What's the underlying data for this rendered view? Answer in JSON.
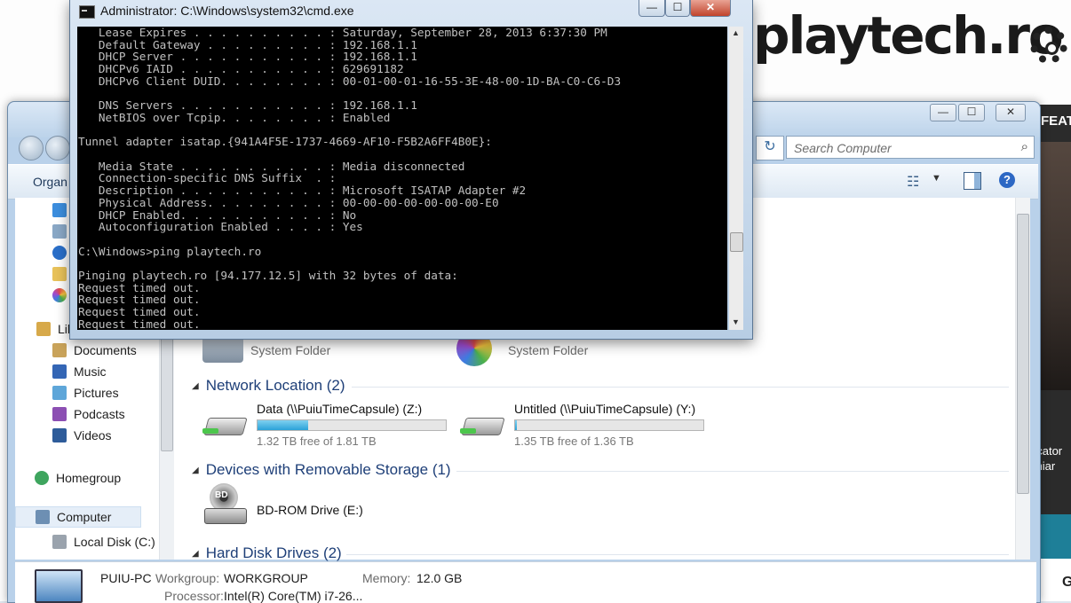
{
  "website": {
    "logo": "playtech.ro",
    "feat": "FEAT",
    "caption": "ucator\nchiar",
    "corner": "G"
  },
  "cmd": {
    "title": "Administrator: C:\\Windows\\system32\\cmd.exe",
    "buttons": {
      "minimize": "—",
      "maximize": "☐",
      "close": "✕"
    },
    "output": "   Lease Expires . . . . . . . . . . : Saturday, September 28, 2013 6:37:30 PM\n   Default Gateway . . . . . . . . . : 192.168.1.1\n   DHCP Server . . . . . . . . . . . : 192.168.1.1\n   DHCPv6 IAID . . . . . . . . . . . : 629691182\n   DHCPv6 Client DUID. . . . . . . . : 00-01-00-01-16-55-3E-48-00-1D-BA-C0-C6-D3\n\n   DNS Servers . . . . . . . . . . . : 192.168.1.1\n   NetBIOS over Tcpip. . . . . . . . : Enabled\n\nTunnel adapter isatap.{941A4F5E-1737-4669-AF10-F5B2A6FF4B0E}:\n\n   Media State . . . . . . . . . . . : Media disconnected\n   Connection-specific DNS Suffix  . :\n   Description . . . . . . . . . . . : Microsoft ISATAP Adapter #2\n   Physical Address. . . . . . . . . : 00-00-00-00-00-00-00-E0\n   DHCP Enabled. . . . . . . . . . . : No\n   Autoconfiguration Enabled . . . . : Yes\n\nC:\\Windows>ping playtech.ro\n\nPinging playtech.ro [94.177.12.5] with 32 bytes of data:\nRequest timed out.\nRequest timed out.\nRequest timed out.\nRequest timed out."
  },
  "explorer": {
    "buttons": {
      "minimize": "—",
      "maximize": "☐",
      "close": "✕"
    },
    "search_placeholder": "Search Computer",
    "toolbar": {
      "organize": "Organ"
    },
    "nav": [
      {
        "label": "",
        "icon": "dropbox-icon",
        "color": "#3d8ede"
      },
      {
        "label": "",
        "icon": "recent-places-icon",
        "color": "#8aa8c6"
      },
      {
        "label": "",
        "icon": "skydrive-icon",
        "color": "#2a6fc9"
      },
      {
        "label": "",
        "icon": "folder-icon",
        "color": "#e8c25a"
      },
      {
        "label": "",
        "icon": "picasa-icon",
        "color": "#e44b4b"
      },
      {
        "label": "Lib",
        "icon": "libraries-icon",
        "color": "#d7a94a"
      },
      {
        "label": "Documents",
        "icon": "documents-icon",
        "color": "#c9a35a"
      },
      {
        "label": "Music",
        "icon": "music-icon",
        "color": "#3466b5"
      },
      {
        "label": "Pictures",
        "icon": "pictures-icon",
        "color": "#5ea6d9"
      },
      {
        "label": "Podcasts",
        "icon": "podcasts-icon",
        "color": "#8c4fb3"
      },
      {
        "label": "Videos",
        "icon": "videos-icon",
        "color": "#2e5c9a"
      },
      {
        "label": "Homegroup",
        "icon": "homegroup-icon",
        "color": "#3ea55e"
      },
      {
        "label": "Computer",
        "icon": "computer-icon",
        "color": "#6d8fb3"
      },
      {
        "label": "Local Disk (C:)",
        "icon": "local-disk-icon",
        "color": "#9aa3ad"
      }
    ],
    "system_folders": [
      {
        "sub": "System Folder"
      },
      {
        "sub": "System Folder"
      }
    ],
    "groups": {
      "network": "Network Location (2)",
      "removable": "Devices with Removable Storage (1)",
      "hdd": "Hard Disk Drives (2)"
    },
    "network_drives": [
      {
        "name": "Data (\\\\PuiuTimeCapsule) (Z:)",
        "free": "1.32 TB free of 1.81 TB",
        "used_fraction": 0.27
      },
      {
        "name": "Untitled (\\\\PuiuTimeCapsule) (Y:)",
        "free": "1.35 TB free of 1.36 TB",
        "used_fraction": 0.01
      }
    ],
    "removable": {
      "name": "BD-ROM Drive (E:)",
      "badge": "BD"
    },
    "details": {
      "pc_name": "PUIU-PC",
      "workgroup_label": "Workgroup:",
      "workgroup": "WORKGROUP",
      "memory_label": "Memory:",
      "memory": "12.0 GB",
      "processor_label": "Processor:",
      "processor": "Intel(R) Core(TM) i7-26..."
    }
  }
}
